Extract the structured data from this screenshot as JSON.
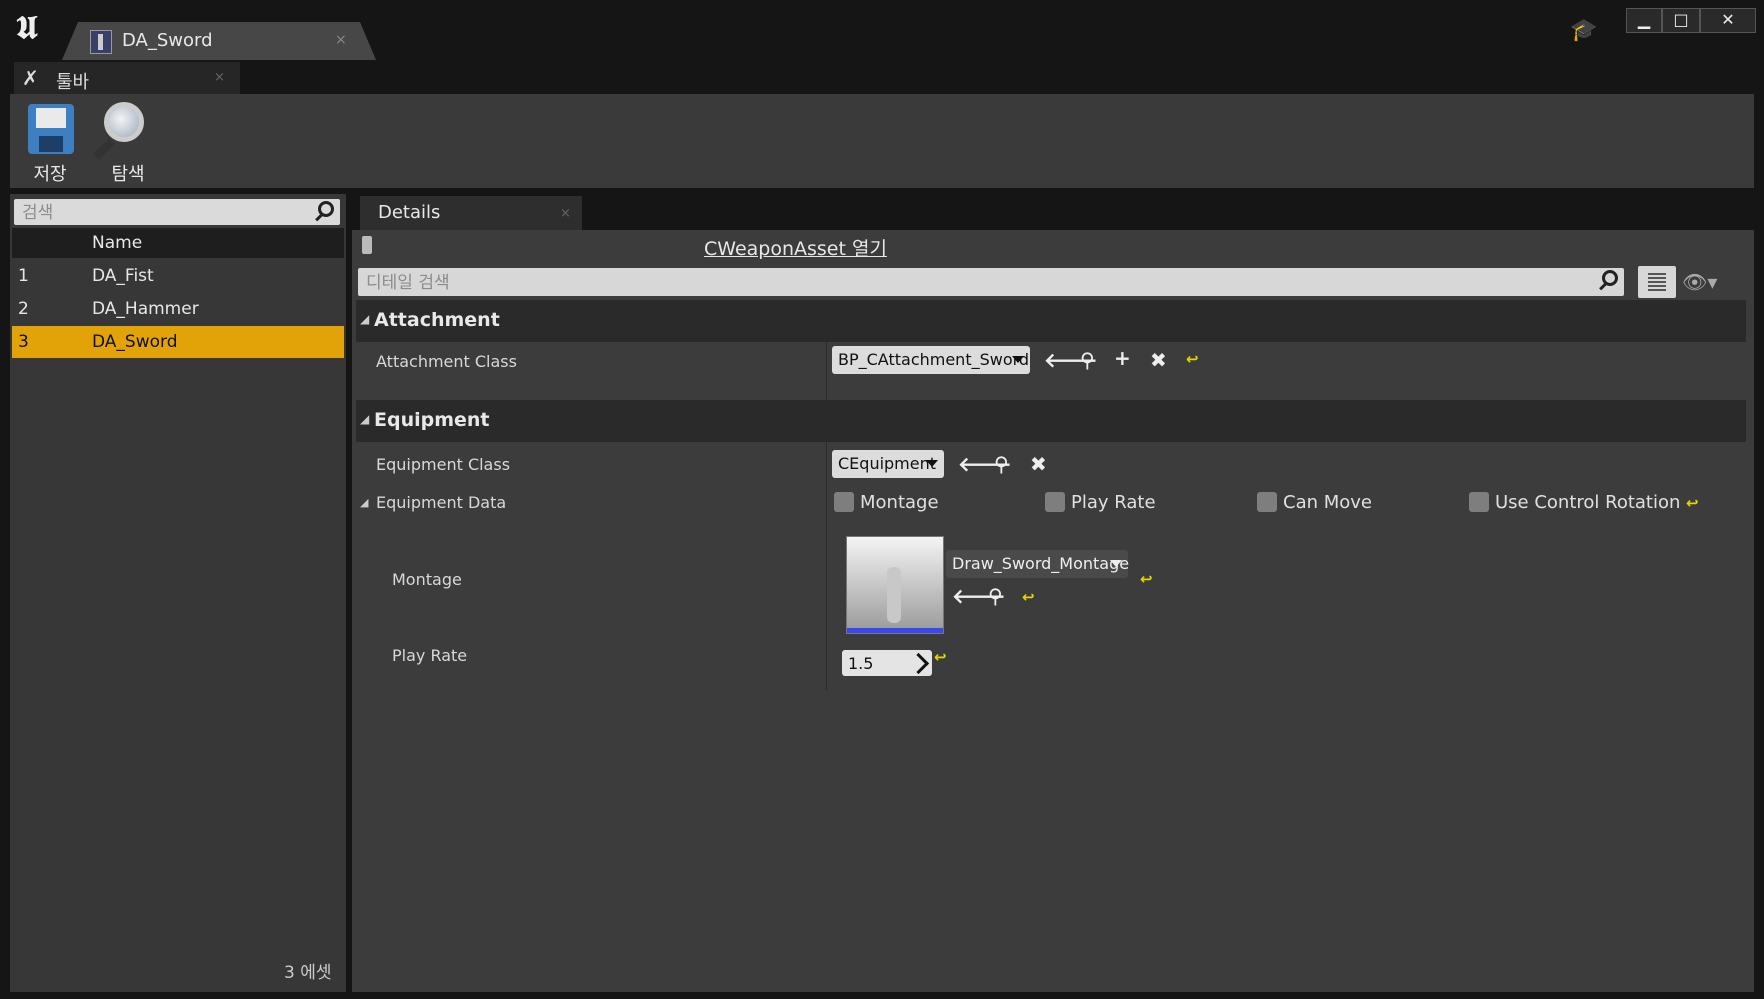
{
  "window": {
    "document_tab": "DA_Sword",
    "close_glyph": "×"
  },
  "toolbar": {
    "tab_label": "툴바",
    "save_label": "저장",
    "browse_label": "탐색"
  },
  "asset_list": {
    "search_placeholder": "검색",
    "column_header": "Name",
    "items": [
      {
        "index": "1",
        "name": "DA_Fist"
      },
      {
        "index": "2",
        "name": "DA_Hammer"
      },
      {
        "index": "3",
        "name": "DA_Sword",
        "selected": true
      }
    ],
    "count_label": "3 에셋"
  },
  "details": {
    "tab_label": "Details",
    "class_link": "CWeaponAsset 열기",
    "search_placeholder": "디테일 검색",
    "attachment": {
      "category": "Attachment",
      "class_label": "Attachment Class",
      "class_value": "BP_CAttachment_Sword"
    },
    "equipment": {
      "category": "Equipment",
      "class_label": "Equipment Class",
      "class_value": "CEquipment",
      "data_label": "Equipment Data",
      "checkboxes": [
        "Montage",
        "Play Rate",
        "Can Move",
        "Use Control Rotation"
      ],
      "montage_label": "Montage",
      "montage_value": "Draw_Sword_Montage",
      "play_rate_label": "Play Rate",
      "play_rate_value": "1.5"
    }
  },
  "colors": {
    "selected_row": "#e1a308",
    "reset_arrow": "#e8d500",
    "panel_bg": "#3c3c3c"
  }
}
